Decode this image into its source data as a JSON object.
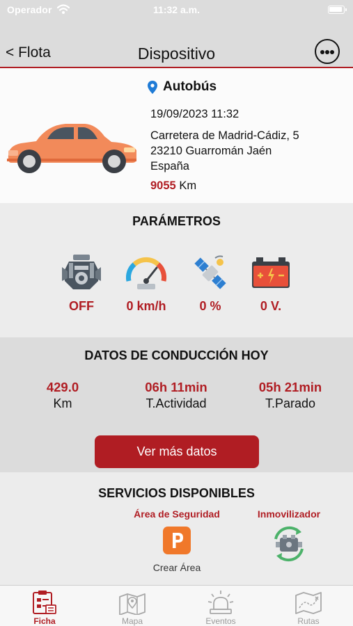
{
  "status_bar": {
    "carrier": "Operador",
    "time": "11:32 a.m."
  },
  "nav": {
    "back_label": "< Flota",
    "title": "Dispositivo"
  },
  "device": {
    "name": "Autobús",
    "datetime": "19/09/2023 11:32",
    "address_line1": "Carretera de Madrid-Cádiz, 5",
    "address_line2": "23210 Guarromán Jaén",
    "address_line3": "España",
    "km_value": "9055",
    "km_unit": "Km"
  },
  "parameters": {
    "title": "PARÁMETROS",
    "items": [
      {
        "icon": "engine-icon",
        "value": "OFF"
      },
      {
        "icon": "speedometer-icon",
        "value": "0 km/h"
      },
      {
        "icon": "satellite-icon",
        "value": "0 %"
      },
      {
        "icon": "battery-icon",
        "value": "0 V."
      }
    ]
  },
  "driving": {
    "title": "DATOS DE CONDUCCIÓN HOY",
    "stats": [
      {
        "value": "429.0",
        "label": "Km"
      },
      {
        "value": "06h 11min",
        "label": "T.Actividad"
      },
      {
        "value": "05h 21min",
        "label": "T.Parado"
      }
    ],
    "button_label": "Ver más datos"
  },
  "services": {
    "title": "SERVICIOS DISPONIBLES",
    "security_area": {
      "label": "Área de Seguridad",
      "action": "Crear Área",
      "icon": "parking-icon"
    },
    "immobilizer": {
      "label": "Inmovilizador",
      "icon": "engine-refresh-icon"
    }
  },
  "tabbar": {
    "tabs": [
      {
        "label": "Ficha",
        "active": true
      },
      {
        "label": "Mapa",
        "active": false
      },
      {
        "label": "Eventos",
        "active": false
      },
      {
        "label": "Rutas",
        "active": false
      }
    ]
  },
  "colors": {
    "accent": "#b01d23",
    "car": "#f28a5a",
    "header_bg": "#dcdcdc"
  }
}
